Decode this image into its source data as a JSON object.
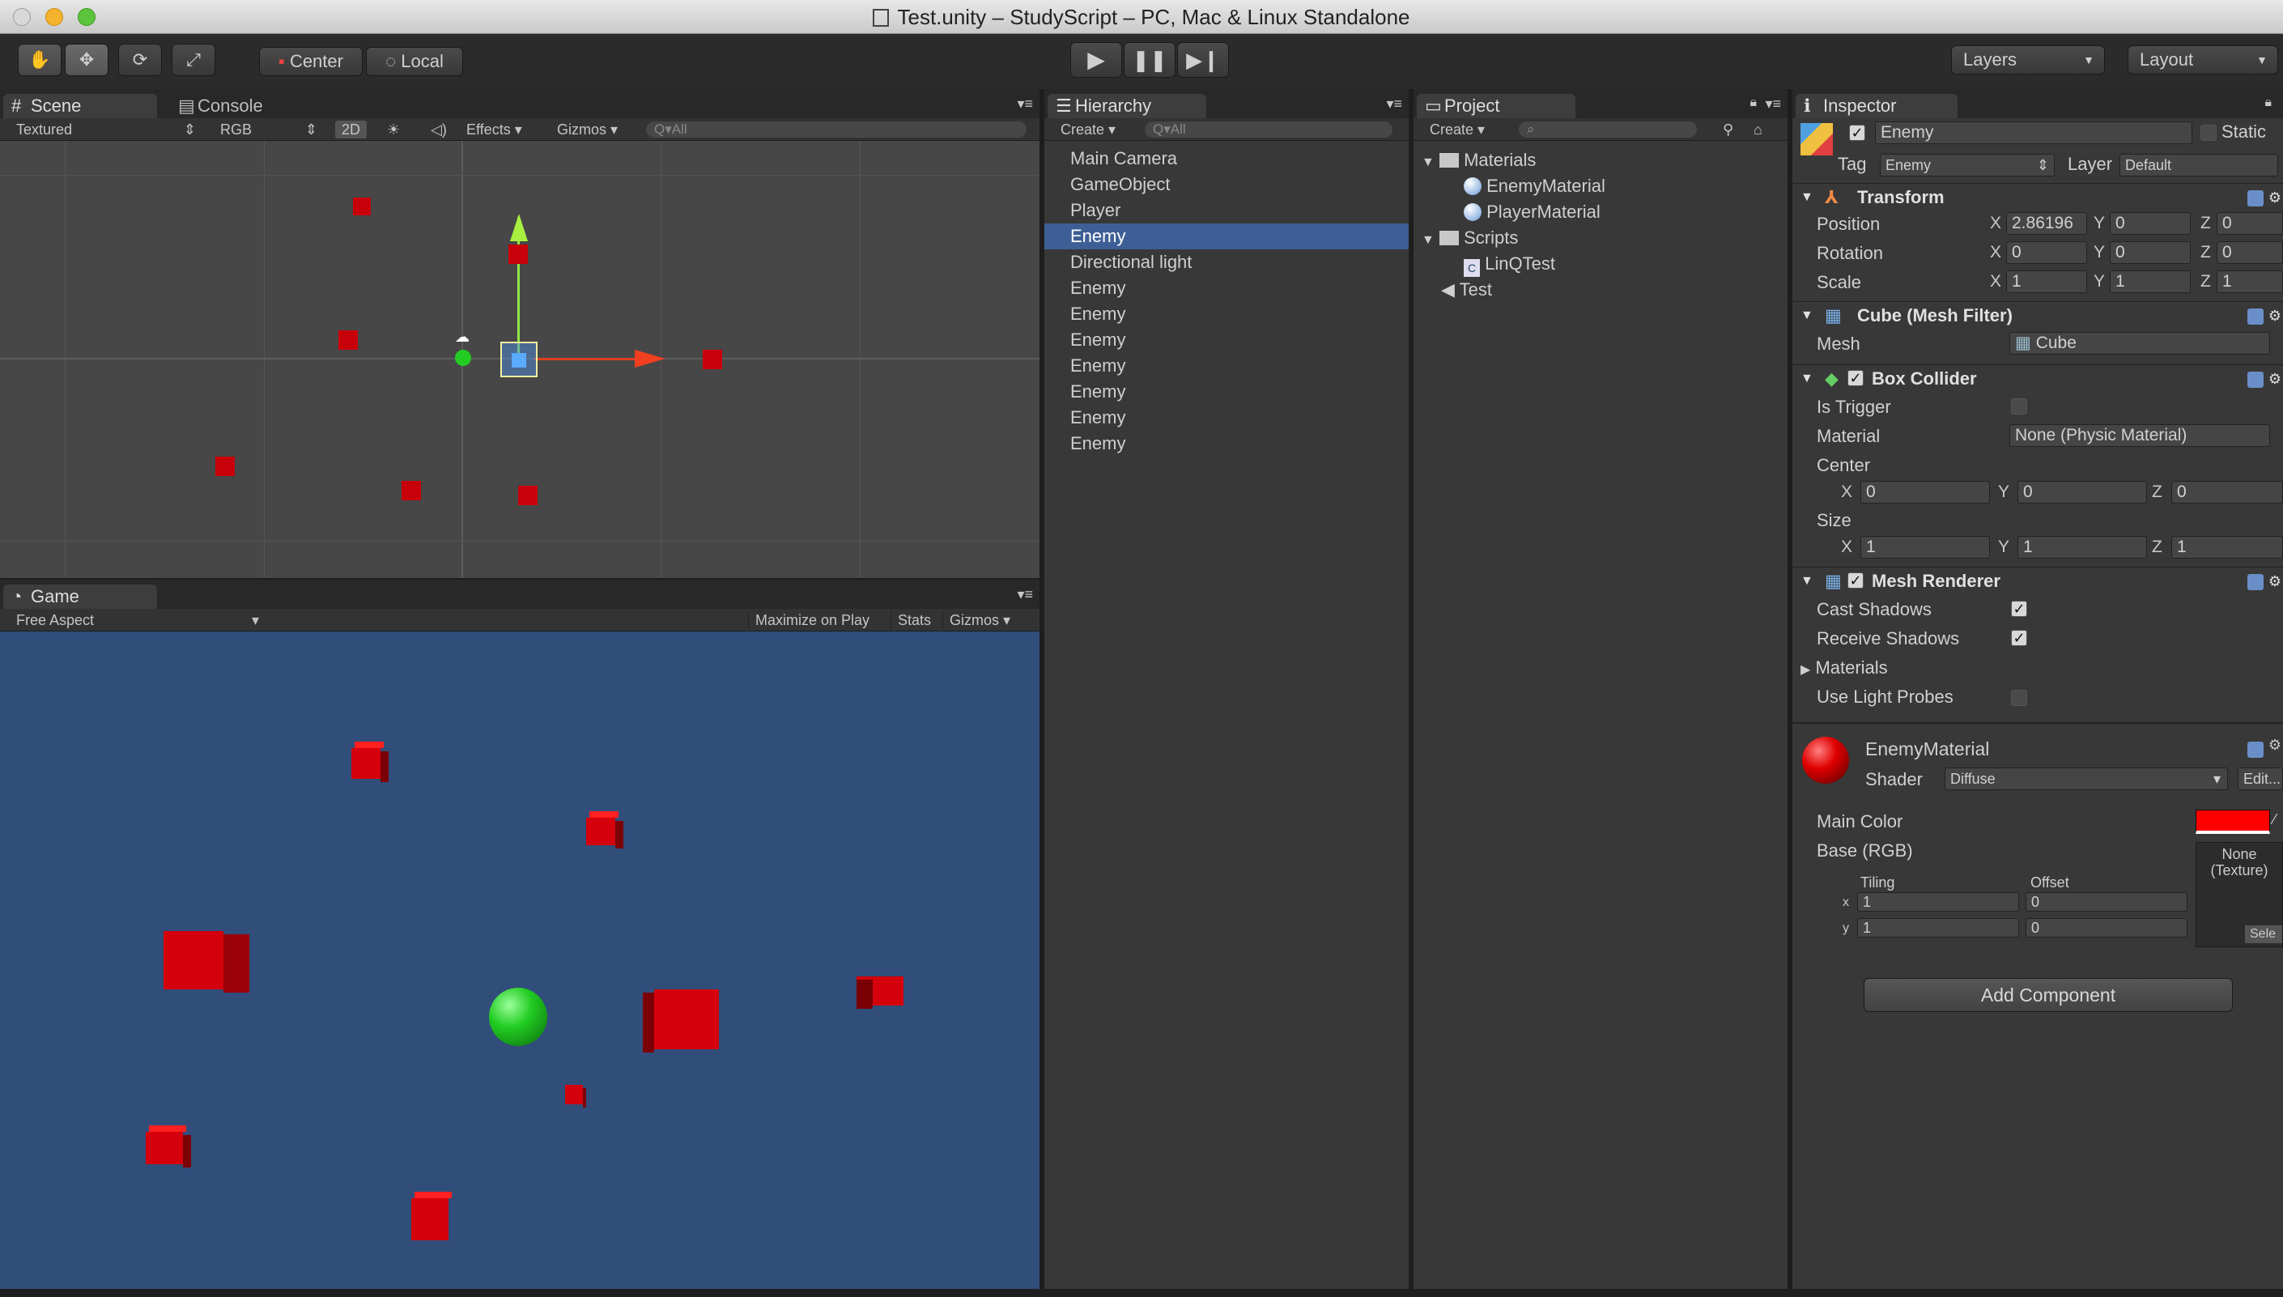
{
  "window": {
    "title": "Test.unity – StudyScript – PC, Mac & Linux Standalone"
  },
  "toolbar": {
    "center_label": "Center",
    "local_label": "Local",
    "layers_label": "Layers",
    "layout_label": "Layout"
  },
  "scene": {
    "tab_scene": "Scene",
    "tab_console": "Console",
    "shading": "Textured",
    "render": "RGB",
    "mode_2d": "2D",
    "effects": "Effects",
    "gizmos": "Gizmos",
    "search_placeholder": "Q▾All"
  },
  "game": {
    "tab": "Game",
    "aspect": "Free Aspect",
    "maximize": "Maximize on Play",
    "stats": "Stats",
    "gizmos": "Gizmos"
  },
  "hierarchy": {
    "tab": "Hierarchy",
    "create": "Create",
    "search_placeholder": "Q▾All",
    "items": [
      "Main Camera",
      "GameObject",
      "Player",
      "Enemy",
      "Directional light",
      "Enemy",
      "Enemy",
      "Enemy",
      "Enemy",
      "Enemy",
      "Enemy",
      "Enemy"
    ],
    "selected_index": 3
  },
  "project": {
    "tab": "Project",
    "create": "Create",
    "folder_materials": "Materials",
    "material_1": "EnemyMaterial",
    "material_2": "PlayerMaterial",
    "folder_scripts": "Scripts",
    "script_1": "LinQTest",
    "scene_asset": "Test"
  },
  "inspector": {
    "tab": "Inspector",
    "object_name": "Enemy",
    "static_label": "Static",
    "tag_label": "Tag",
    "tag_value": "Enemy",
    "layer_label": "Layer",
    "layer_value": "Default",
    "transform": {
      "title": "Transform",
      "position_label": "Position",
      "rotation_label": "Rotation",
      "scale_label": "Scale",
      "pos": [
        "2.86196",
        "0",
        "0"
      ],
      "rot": [
        "0",
        "0",
        "0"
      ],
      "scl": [
        "1",
        "1",
        "1"
      ]
    },
    "mesh_filter": {
      "title": "Cube (Mesh Filter)",
      "mesh_label": "Mesh",
      "mesh_value": "Cube"
    },
    "box_collider": {
      "title": "Box Collider",
      "is_trigger_label": "Is Trigger",
      "material_label": "Material",
      "material_value": "None (Physic Material)",
      "center_label": "Center",
      "center": [
        "0",
        "0",
        "0"
      ],
      "size_label": "Size",
      "size": [
        "1",
        "1",
        "1"
      ]
    },
    "mesh_renderer": {
      "title": "Mesh Renderer",
      "cast_shadows_label": "Cast Shadows",
      "receive_shadows_label": "Receive Shadows",
      "materials_label": "Materials",
      "light_probes_label": "Use Light Probes"
    },
    "material": {
      "name": "EnemyMaterial",
      "shader_label": "Shader",
      "shader_value": "Diffuse",
      "edit_label": "Edit...",
      "main_color_label": "Main Color",
      "base_label": "Base (RGB)",
      "texture_none": "None",
      "texture_type": "(Texture)",
      "tiling_label": "Tiling",
      "offset_label": "Offset",
      "tiling_x": "1",
      "tiling_y": "1",
      "offset_x": "0",
      "offset_y": "0",
      "select_label": "Sele",
      "main_color": "#ff0000"
    },
    "add_component": "Add Component"
  },
  "colors": {
    "selection": "#3e5f96",
    "game_bg": "#314d7a",
    "enemy": "#d4000b",
    "player": "#22cc22"
  }
}
